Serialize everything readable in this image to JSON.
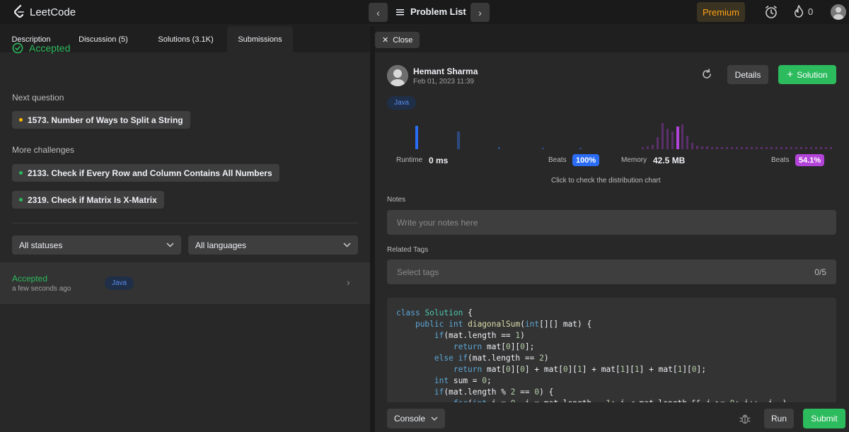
{
  "topbar": {
    "logo_text": "LeetCode",
    "problem_list_label": "Problem List",
    "premium_label": "Premium",
    "streak_count": "0"
  },
  "left": {
    "tabs": [
      {
        "label": "Description"
      },
      {
        "label": "Discussion (5)"
      },
      {
        "label": "Solutions (3.1K)"
      },
      {
        "label": "Submissions"
      }
    ],
    "active_tab": "Submissions",
    "status_heading": "Accepted",
    "next_question_label": "Next question",
    "next_question": {
      "title": "1573. Number of Ways to Split a String",
      "dot_color": "#ffb800"
    },
    "more_challenges_label": "More challenges",
    "challenges": [
      {
        "title": "2133. Check if Every Row and Column Contains All Numbers",
        "dot_color": "#2cbb5d"
      },
      {
        "title": "2319. Check if Matrix Is X-Matrix",
        "dot_color": "#2cbb5d"
      }
    ],
    "filter_status": "All statuses",
    "filter_language": "All languages",
    "submission": {
      "status": "Accepted",
      "time": "a few seconds ago",
      "language": "Java"
    }
  },
  "right": {
    "close_label": "Close",
    "user": {
      "name": "Hemant Sharma",
      "date": "Feb 01, 2023 11:39"
    },
    "details_label": "Details",
    "solution_label": "Solution",
    "language_badge": "Java",
    "runtime": {
      "label": "Runtime",
      "value": "0 ms",
      "beats_label": "Beats",
      "beats_value": "100%"
    },
    "memory": {
      "label": "Memory",
      "value": "42.5 MB",
      "beats_label": "Beats",
      "beats_value": "54.1%"
    },
    "distribution_hint": "Click to check the distribution chart",
    "notes_label": "Notes",
    "notes_placeholder": "Write your notes here",
    "tags_label": "Related Tags",
    "tags_placeholder": "Select tags",
    "tags_count": "0/5",
    "console_label": "Console",
    "run_label": "Run",
    "submit_label": "Submit"
  },
  "colors": {
    "accent_green": "#2cbb5d",
    "premium_orange": "#ffa116",
    "runtime_blue": "#2a6df4",
    "memory_purple": "#b344d9"
  },
  "icons": [
    "leetcode-logo-icon",
    "chevron-left-icon",
    "chevron-right-icon",
    "list-icon",
    "alarm-icon",
    "fire-icon",
    "avatar",
    "check-circle-icon",
    "chevron-down-icon",
    "close-icon",
    "refresh-icon",
    "plus-icon",
    "bug-icon"
  ]
}
